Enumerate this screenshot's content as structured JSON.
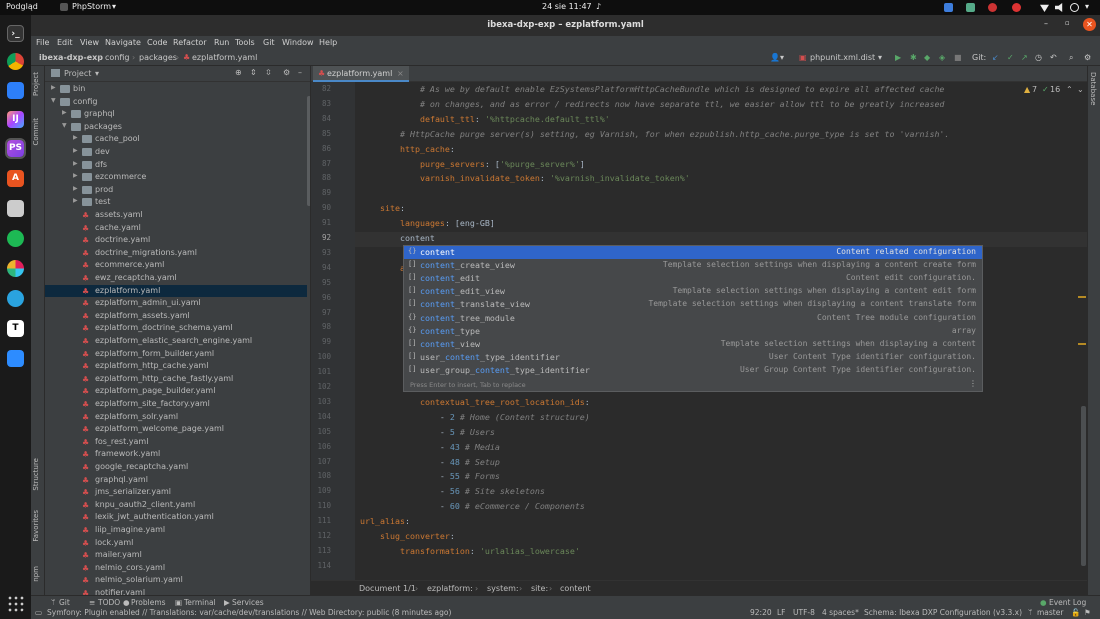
{
  "topbar": {
    "app_menu": "Podgląd",
    "active_app": "PhpStorm",
    "clock": "24 sie  11:47"
  },
  "window": {
    "title": "ibexa-dxp-exp – ezplatform.yaml"
  },
  "menu": [
    "File",
    "Edit",
    "View",
    "Navigate",
    "Code",
    "Refactor",
    "Run",
    "Tools",
    "Git",
    "Window",
    "Help"
  ],
  "nav": {
    "breadcrumb": [
      "ibexa-dxp-exp",
      "config",
      "packages",
      "ezplatform.yaml"
    ],
    "run_config": "phpunit.xml.dist",
    "git_label": "Git:"
  },
  "project": {
    "title": "Project",
    "tree": [
      {
        "label": "bin",
        "type": "folder",
        "depth": 1,
        "expanded": false
      },
      {
        "label": "config",
        "type": "folder",
        "depth": 1,
        "expanded": true
      },
      {
        "label": "graphql",
        "type": "folder",
        "depth": 2,
        "expanded": false
      },
      {
        "label": "packages",
        "type": "folder",
        "depth": 2,
        "expanded": true
      },
      {
        "label": "cache_pool",
        "type": "folder",
        "depth": 3,
        "expanded": false
      },
      {
        "label": "dev",
        "type": "folder",
        "depth": 3,
        "expanded": false
      },
      {
        "label": "dfs",
        "type": "folder",
        "depth": 3,
        "expanded": false
      },
      {
        "label": "ezcommerce",
        "type": "folder",
        "depth": 3,
        "expanded": false
      },
      {
        "label": "prod",
        "type": "folder",
        "depth": 3,
        "expanded": false
      },
      {
        "label": "test",
        "type": "folder",
        "depth": 3,
        "expanded": false
      },
      {
        "label": "assets.yaml",
        "type": "yaml",
        "depth": 3
      },
      {
        "label": "cache.yaml",
        "type": "yaml",
        "depth": 3
      },
      {
        "label": "doctrine.yaml",
        "type": "yaml",
        "depth": 3
      },
      {
        "label": "doctrine_migrations.yaml",
        "type": "yaml",
        "depth": 3
      },
      {
        "label": "ecommerce.yaml",
        "type": "yaml",
        "depth": 3
      },
      {
        "label": "ewz_recaptcha.yaml",
        "type": "yaml",
        "depth": 3
      },
      {
        "label": "ezplatform.yaml",
        "type": "yaml",
        "depth": 3,
        "selected": true
      },
      {
        "label": "ezplatform_admin_ui.yaml",
        "type": "yaml",
        "depth": 3
      },
      {
        "label": "ezplatform_assets.yaml",
        "type": "yaml",
        "depth": 3
      },
      {
        "label": "ezplatform_doctrine_schema.yaml",
        "type": "yaml",
        "depth": 3
      },
      {
        "label": "ezplatform_elastic_search_engine.yaml",
        "type": "yaml",
        "depth": 3
      },
      {
        "label": "ezplatform_form_builder.yaml",
        "type": "yaml",
        "depth": 3
      },
      {
        "label": "ezplatform_http_cache.yaml",
        "type": "yaml",
        "depth": 3
      },
      {
        "label": "ezplatform_http_cache_fastly.yaml",
        "type": "yaml",
        "depth": 3
      },
      {
        "label": "ezplatform_page_builder.yaml",
        "type": "yaml",
        "depth": 3
      },
      {
        "label": "ezplatform_site_factory.yaml",
        "type": "yaml",
        "depth": 3
      },
      {
        "label": "ezplatform_solr.yaml",
        "type": "yaml",
        "depth": 3
      },
      {
        "label": "ezplatform_welcome_page.yaml",
        "type": "yaml",
        "depth": 3
      },
      {
        "label": "fos_rest.yaml",
        "type": "yaml",
        "depth": 3
      },
      {
        "label": "framework.yaml",
        "type": "yaml",
        "depth": 3
      },
      {
        "label": "google_recaptcha.yaml",
        "type": "yaml",
        "depth": 3
      },
      {
        "label": "graphql.yaml",
        "type": "yaml",
        "depth": 3
      },
      {
        "label": "jms_serializer.yaml",
        "type": "yaml",
        "depth": 3
      },
      {
        "label": "knpu_oauth2_client.yaml",
        "type": "yaml",
        "depth": 3
      },
      {
        "label": "lexik_jwt_authentication.yaml",
        "type": "yaml",
        "depth": 3
      },
      {
        "label": "liip_imagine.yaml",
        "type": "yaml",
        "depth": 3
      },
      {
        "label": "lock.yaml",
        "type": "yaml",
        "depth": 3
      },
      {
        "label": "mailer.yaml",
        "type": "yaml",
        "depth": 3
      },
      {
        "label": "nelmio_cors.yaml",
        "type": "yaml",
        "depth": 3
      },
      {
        "label": "nelmio_solarium.yaml",
        "type": "yaml",
        "depth": 3
      },
      {
        "label": "notifier.yaml",
        "type": "yaml",
        "depth": 3
      }
    ]
  },
  "left_tool_windows": [
    "Project",
    "Commit",
    "Structure",
    "Favorites",
    "npm"
  ],
  "right_tool_windows": [
    "Database"
  ],
  "editor": {
    "tab": "ezplatform.yaml",
    "inspections": {
      "warnings": "7",
      "ok": "16"
    },
    "lines": [
      {
        "n": "82",
        "html": "<span class='cm'>            # As we by default enable EzSystemsPlatformHttpCacheBundle which is designed to expire all affected cache</span>"
      },
      {
        "n": "83",
        "html": "<span class='cm'>            # on changes, and as error / redirects now have separate ttl, we easier allow ttl to be greatly increased</span>"
      },
      {
        "n": "84",
        "html": "            <span class='kw'>default_ttl</span>: <span class='str'>'%httpcache.default_ttl%'</span>"
      },
      {
        "n": "85",
        "html": "<span class='cm'>        # HttpCache purge server(s) setting, eg Varnish, for when ezpublish.http_cache.purge_type is set to 'varnish'.</span>"
      },
      {
        "n": "86",
        "html": "        <span class='kw'>http_cache</span>:"
      },
      {
        "n": "87",
        "html": "            <span class='kw'>purge_servers</span>: [<span class='str'>'%purge_server%'</span>]"
      },
      {
        "n": "88",
        "html": "            <span class='kw'>varnish_invalidate_token</span>: <span class='str'>'%varnish_invalidate_token%'</span>"
      },
      {
        "n": "89",
        "html": ""
      },
      {
        "n": "90",
        "html": "    <span class='kw'>site</span>:"
      },
      {
        "n": "91",
        "html": "        <span class='kw'>languages</span>: [eng-GB]"
      },
      {
        "n": "92",
        "html": "        content"
      },
      {
        "n": "93",
        "html": ""
      },
      {
        "n": "94",
        "html": "        <span class='kw'>a</span>"
      },
      {
        "n": "95",
        "html": ""
      },
      {
        "n": "96",
        "html": ""
      },
      {
        "n": "97",
        "html": ""
      },
      {
        "n": "98",
        "html": ""
      },
      {
        "n": "99",
        "html": ""
      },
      {
        "n": "100",
        "html": ""
      },
      {
        "n": "101",
        "html": ""
      },
      {
        "n": "102",
        "html": ""
      },
      {
        "n": "103",
        "html": "            <span class='kw'>contextual_tree_root_location_ids</span>:"
      },
      {
        "n": "104",
        "html": "                - <span class='num'>2</span> <span class='cm'># Home (Content structure)</span>"
      },
      {
        "n": "105",
        "html": "                - <span class='num'>5</span> <span class='cm'># Users</span>"
      },
      {
        "n": "106",
        "html": "                - <span class='num'>43</span> <span class='cm'># Media</span>"
      },
      {
        "n": "107",
        "html": "                - <span class='num'>48</span> <span class='cm'># Setup</span>"
      },
      {
        "n": "108",
        "html": "                - <span class='num'>55</span> <span class='cm'># Forms</span>"
      },
      {
        "n": "109",
        "html": "                - <span class='num'>56</span> <span class='cm'># Site skeletons</span>"
      },
      {
        "n": "110",
        "html": "                - <span class='num'>60</span> <span class='cm'># eCommerce / Components</span>"
      },
      {
        "n": "111",
        "html": "<span class='kw'>url_alias</span>:"
      },
      {
        "n": "112",
        "html": "    <span class='kw'>slug_converter</span>:"
      },
      {
        "n": "113",
        "html": "        <span class='kw'>transformation</span>: <span class='str'>'urlalias_lowercase'</span>"
      },
      {
        "n": "114",
        "html": ""
      }
    ]
  },
  "completion": {
    "items": [
      {
        "pre": "",
        "match": "content",
        "post": "",
        "desc": "Content related configuration",
        "selected": true
      },
      {
        "pre": "",
        "match": "content",
        "post": "_create_view",
        "desc": "Template selection settings when displaying a content create form"
      },
      {
        "pre": "",
        "match": "content",
        "post": "_edit",
        "desc": "Content edit configuration."
      },
      {
        "pre": "",
        "match": "content",
        "post": "_edit_view",
        "desc": "Template selection settings when displaying a content edit form"
      },
      {
        "pre": "",
        "match": "content",
        "post": "_translate_view",
        "desc": "Template selection settings when displaying a content translate form"
      },
      {
        "pre": "",
        "match": "content",
        "post": "_tree_module",
        "desc": "Content Tree module configuration"
      },
      {
        "pre": "",
        "match": "content",
        "post": "_type",
        "desc": "array"
      },
      {
        "pre": "",
        "match": "content",
        "post": "_view",
        "desc": "Template selection settings when displaying a content"
      },
      {
        "pre": "user_",
        "match": "content",
        "post": "_type_identifier",
        "desc": "User Content Type identifier configuration."
      },
      {
        "pre": "user_group_",
        "match": "content",
        "post": "_type_identifier",
        "desc": "User Group Content Type identifier configuration."
      }
    ],
    "hint": "Press Enter to insert, Tab to replace"
  },
  "breadcrumbs": [
    "Document 1/1",
    "ezplatform:",
    "system:",
    "site:",
    "content"
  ],
  "bottom_tools": [
    "Git",
    "TODO",
    "Problems",
    "Terminal",
    "Services",
    "Event Log"
  ],
  "status": {
    "message": "Symfony: Plugin enabled // Translations: var/cache/dev/translations // Web Directory: public (8 minutes ago)",
    "position": "92:20",
    "line_sep": "LF",
    "encoding": "UTF-8",
    "indent": "4 spaces*",
    "schema": "Schema: Ibexa DXP Configuration (v3.3.x)",
    "branch": "master"
  },
  "colors": {
    "selection": "#2f65ca",
    "keyword": "#cc7832",
    "string": "#6a8759",
    "comment": "#808080"
  }
}
